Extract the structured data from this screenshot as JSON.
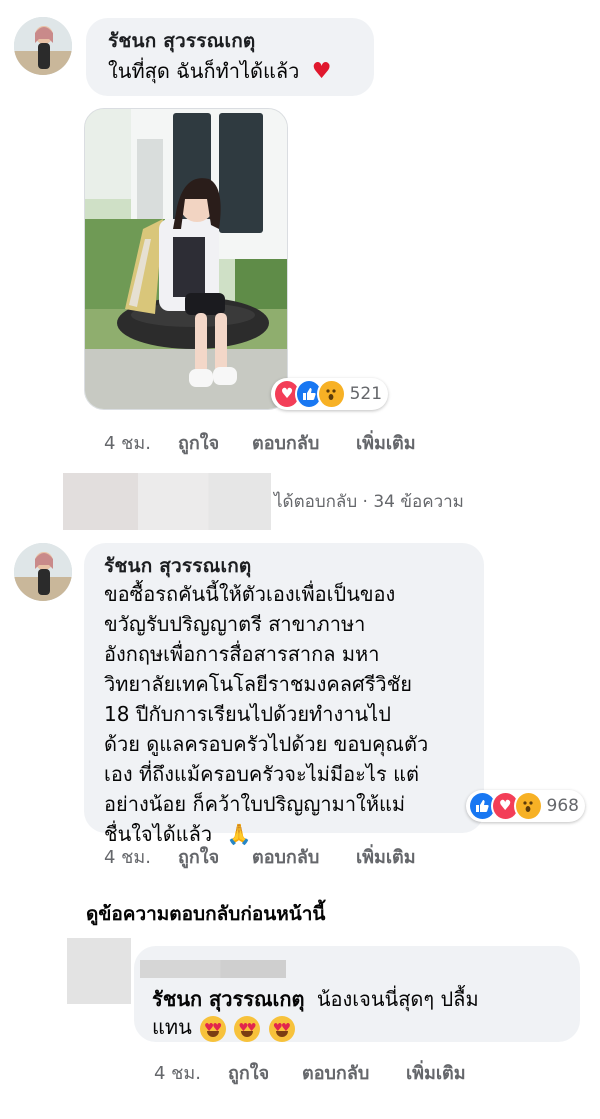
{
  "comment1": {
    "author": "รัชนก สุวรรณเกตุ",
    "text": "ในที่สุด ฉันก็ทำได้แล้ว",
    "reaction_count": "521",
    "reaction_icons": [
      "heart-icon",
      "like-icon",
      "wow-icon"
    ],
    "time": "4 ชม.",
    "like": "ถูกใจ",
    "reply": "ตอบกลับ",
    "more": "เพิ่มเติม"
  },
  "replies_summary": {
    "text": "ได้ตอบกลับ · 34 ข้อความ"
  },
  "comment2": {
    "author": "รัชนก สุวรรณเกตุ",
    "lines": [
      "ขอซื้อรถคันนี้ให้ตัวเองเพื่อเป็นของ",
      "ขวัญรับปริญญาตรี สาขาภาษา",
      "อังกฤษเพื่อการสื่อสารสากล มหา",
      "วิทยาลัยเทคโนโลยีราชมงคลศรีวิชัย",
      "18 ปีกับการเรียนไปด้วยทำงานไป",
      "ด้วย ดูแลครอบครัวไปด้วย ขอบคุณตัว",
      "เอง ที่ถึงแม้ครอบครัวจะไม่มีอะไร แต่",
      "อย่างน้อย ก็คว้าใบปริญญามาให้แม่",
      "ชื่นใจได้แล้ว"
    ],
    "reaction_count": "968",
    "reaction_icons": [
      "like-icon",
      "heart-icon",
      "wow-icon"
    ],
    "time": "4 ชม.",
    "like": "ถูกใจ",
    "reply": "ตอบกลับ",
    "more": "เพิ่มเติม"
  },
  "previous_replies": {
    "label": "ดูข้อความตอบกลับก่อนหน้านี้"
  },
  "reply1": {
    "mention": "รัชนก สุวรรณเกตุ",
    "text": "น้องเจนนี่สุดๆ ปลื้ม",
    "text2": "แทน",
    "time": "4 ชม.",
    "like": "ถูกใจ",
    "reply": "ตอบกลับ",
    "more": "เพิ่มเติม"
  },
  "colors": {
    "bubble": "#f0f2f5",
    "meta_text": "#65676b",
    "heart": "#f33e58",
    "like": "#1877f2",
    "wow": "#f7b125"
  }
}
